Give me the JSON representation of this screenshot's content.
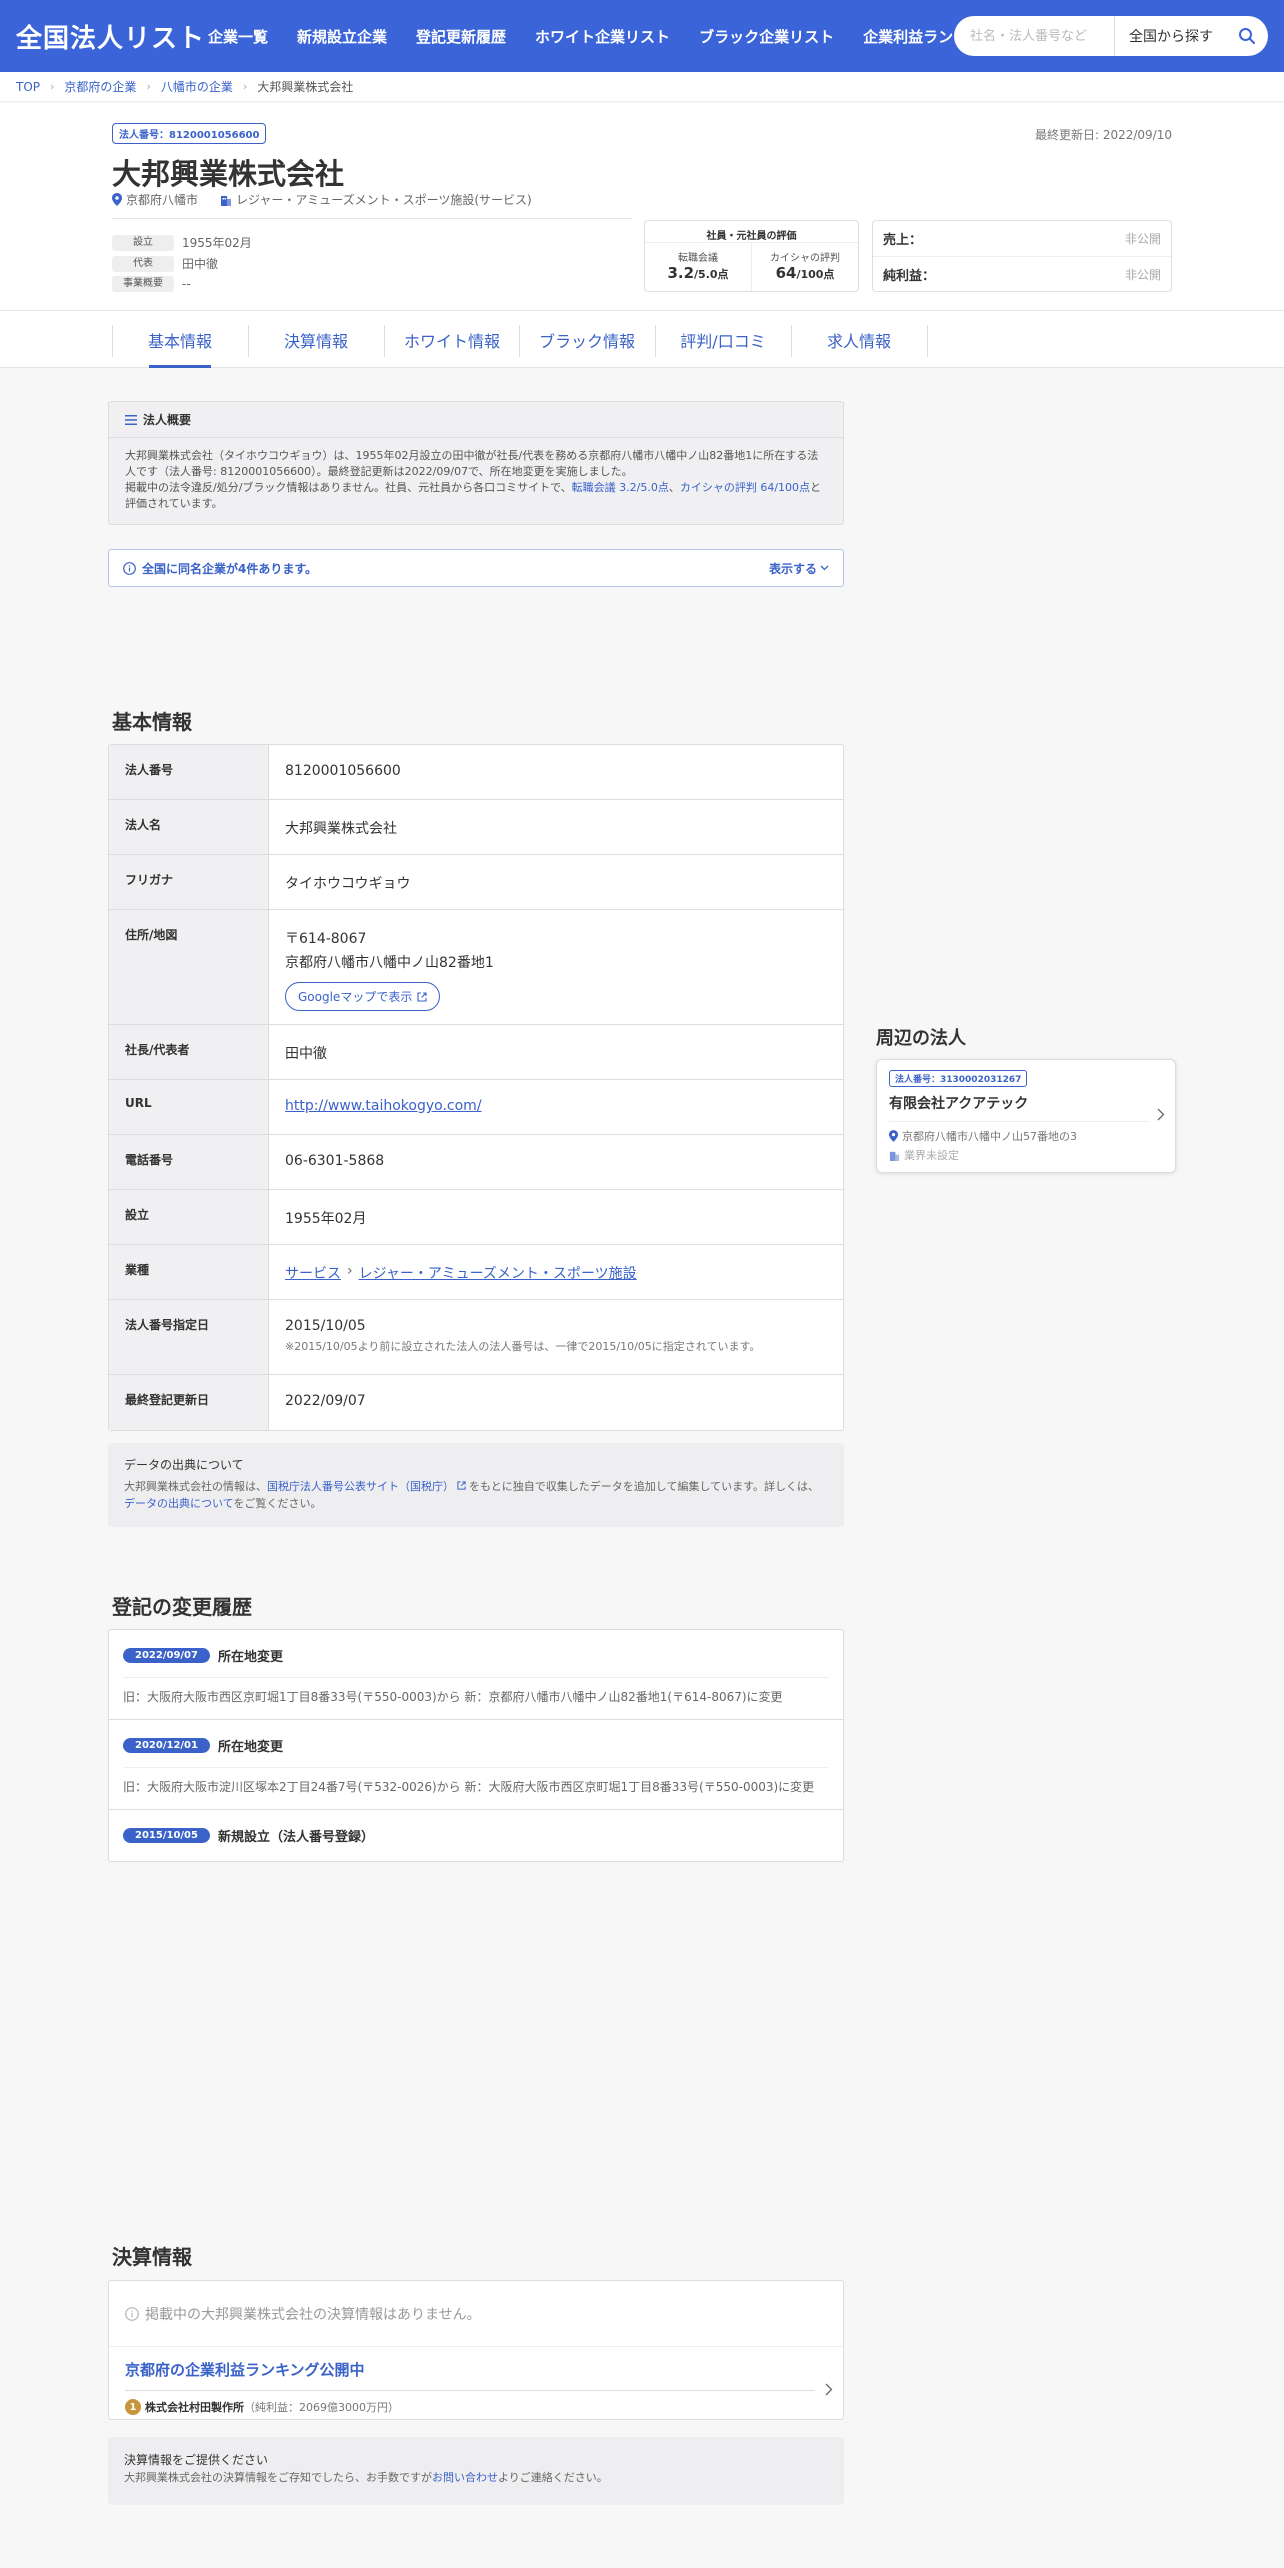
{
  "header": {
    "logo": "全国法人リスト",
    "nav": [
      "企業一覧",
      "新規設立企業",
      "登記更新履歴",
      "ホワイト企業リスト",
      "ブラック企業リスト",
      "企業利益ランキング"
    ],
    "search_placeholder": "社名・法人番号など",
    "search_area": "全国から探す",
    "search_icon": "search-icon"
  },
  "breadcrumb": [
    "TOP",
    "京都府の企業",
    "八幡市の企業",
    "大邦興業株式会社"
  ],
  "company": {
    "corp_number_badge": "法人番号：8120001056600",
    "updated": "最終更新日: 2022/09/10",
    "name": "大邦興業株式会社",
    "location": "京都府八幡市",
    "industry": "レジャー・アミューズメント・スポーツ施設(サービス)",
    "facts": [
      {
        "label": "設立",
        "value": "1955年02月"
      },
      {
        "label": "代表",
        "value": "田中徹"
      },
      {
        "label": "事業概要",
        "value": "--"
      }
    ],
    "evaluation": {
      "title": "社員・元社員の評価",
      "items": [
        {
          "label": "転職会議",
          "score": "3.2",
          "unit": "/5.0点"
        },
        {
          "label": "カイシャの評判",
          "score": "64",
          "unit": "/100点"
        }
      ]
    },
    "sales": [
      {
        "label": "売上：",
        "value": "非公開"
      },
      {
        "label": "純利益：",
        "value": "非公開"
      }
    ]
  },
  "tabs": [
    "基本情報",
    "決算情報",
    "ホワイト情報",
    "ブラック情報",
    "評判/口コミ",
    "求人情報"
  ],
  "summary": {
    "title": "法人概要",
    "text1": "大邦興業株式会社（タイホウコウギョウ）は、1955年02月設立の田中徹が社長/代表を務める京都府八幡市八幡中ノ山82番地1に所在する法人です（法人番号: 8120001056600）。最終登記更新は2022/09/07で、所在地変更を実施しました。",
    "text2_pre": "掲載中の法令違反/処分/ブラック情報はありません。社員、元社員から各口コミサイトで、",
    "text2_link1": "転職会議 3.2/5.0点",
    "text2_mid": "、",
    "text2_link2": "カイシャの評判 64/100点",
    "text2_post": "と評価されています。"
  },
  "samename": {
    "text": "全国に同名企業が4件あります。",
    "toggle": "表示する"
  },
  "basic": {
    "title": "基本情報",
    "rows": {
      "corp_number": {
        "key": "法人番号",
        "value": "8120001056600"
      },
      "corp_name": {
        "key": "法人名",
        "value": "大邦興業株式会社"
      },
      "furigana": {
        "key": "フリガナ",
        "value": "タイホウコウギョウ"
      },
      "address": {
        "key": "住所/地図",
        "zip": "〒614-8067",
        "value": "京都府八幡市八幡中ノ山82番地1",
        "map_button": "Googleマップで表示"
      },
      "ceo": {
        "key": "社長/代表者",
        "value": "田中徹"
      },
      "url": {
        "key": "URL",
        "value": "http://www.taihokogyo.com/"
      },
      "phone": {
        "key": "電話番号",
        "value": "06-6301-5868"
      },
      "founded": {
        "key": "設立",
        "value": "1955年02月"
      },
      "industry": {
        "key": "業種",
        "cat1": "サービス",
        "cat2": "レジャー・アミューズメント・スポーツ施設"
      },
      "designated": {
        "key": "法人番号指定日",
        "value": "2015/10/05",
        "note": "※2015/10/05より前に設立された法人の法人番号は、一律で2015/10/05に指定されています。"
      },
      "last_reg": {
        "key": "最終登記更新日",
        "value": "2022/09/07"
      }
    }
  },
  "source": {
    "title": "データの出典について",
    "pre": "大邦興業株式会社の情報は、",
    "link1": "国税庁法人番号公表サイト（国税庁）",
    "mid": "をもとに独自で収集したデータを追加して編集しています。詳しくは、",
    "link2": "データの出典について",
    "post": "をご覧ください。"
  },
  "history": {
    "title": "登記の変更履歴",
    "items": [
      {
        "date": "2022/09/07",
        "title": "所在地変更",
        "desc": "旧：大阪府大阪市西区京町堀1丁目8番33号(〒550-0003)から 新：京都府八幡市八幡中ノ山82番地1(〒614-8067)に変更"
      },
      {
        "date": "2020/12/01",
        "title": "所在地変更",
        "desc": "旧：大阪府大阪市淀川区塚本2丁目24番7号(〒532-0026)から 新：大阪府大阪市西区京町堀1丁目8番33号(〒550-0003)に変更"
      },
      {
        "date": "2015/10/05",
        "title": "新規設立（法人番号登録）",
        "desc": ""
      }
    ]
  },
  "financial": {
    "title": "決算情報",
    "empty": "掲載中の大邦興業株式会社の決算情報はありません。",
    "ranking_title": "京都府の企業利益ランキング公開中",
    "rank_no": "1",
    "rank_company": "株式会社村田製作所",
    "rank_profit": "（純利益：2069億3000万円）",
    "provide_title": "決算情報をご提供ください",
    "provide_pre": "大邦興業株式会社の決算情報をご存知でしたら、お手数ですが",
    "provide_link": "お問い合わせ",
    "provide_post": "よりご連絡ください。"
  },
  "nearby": {
    "title": "周辺の法人",
    "badge": "法人番号：3130002031267",
    "name": "有限会社アクアテック",
    "address": "京都府八幡市八幡中ノ山57番地の3",
    "industry": "業界未設定"
  }
}
